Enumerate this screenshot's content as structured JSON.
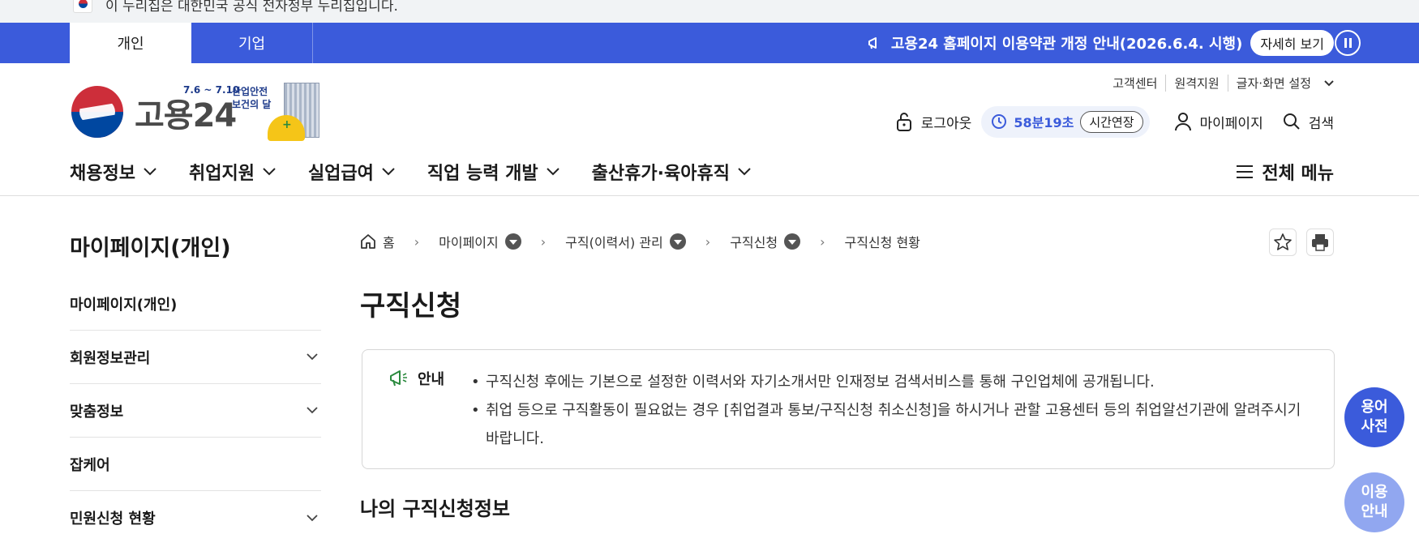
{
  "gov_banner": {
    "text": "이 누리집은 대한민국 공식 전자정부 누리집입니다."
  },
  "notice_bar": {
    "tabs": [
      {
        "label": "개인",
        "active": true
      },
      {
        "label": "기업",
        "active": false
      }
    ],
    "notice": "고용24 홈페이지 이용약관 개정 안내(2026.6.4. 시행)",
    "detail_label": "자세히 보기",
    "bg_color": "#3b5bdb"
  },
  "header": {
    "logo_text": "고용24",
    "campaign": {
      "date": "7.6 ~ 7.10",
      "line1": "산업안전",
      "line2": "보건의 달"
    },
    "util_links": [
      "고객센터",
      "원격지원",
      "글자·화면 설정"
    ],
    "logout_label": "로그아웃",
    "timer_remaining": "58분19초",
    "extend_label": "시간연장",
    "mypage_label": "마이페이지",
    "search_label": "검색"
  },
  "main_nav": {
    "items": [
      "채용정보",
      "취업지원",
      "실업급여",
      "직업 능력 개발",
      "출산휴가·육아휴직"
    ],
    "all_menu_label": "전체 메뉴"
  },
  "sidebar": {
    "title": "마이페이지(개인)",
    "items": [
      {
        "label": "마이페이지(개인)",
        "expandable": false
      },
      {
        "label": "회원정보관리",
        "expandable": true
      },
      {
        "label": "맞춤정보",
        "expandable": true
      },
      {
        "label": "잡케어",
        "expandable": false
      },
      {
        "label": "민원신청 현황",
        "expandable": true
      }
    ]
  },
  "breadcrumb": [
    "홈",
    "마이페이지",
    "구직(이력서) 관리",
    "구직신청",
    "구직신청 현황"
  ],
  "page": {
    "title": "구직신청",
    "info_label": "안내",
    "info_items": [
      "구직신청 후에는 기본으로 설정한 이력서와 자기소개서만 인재정보 검색서비스를 통해 구인업체에 공개됩니다.",
      "취업 등으로 구직활동이 필요없는 경우 [취업결과 통보/구직신청 취소신청]을 하시거나 관할 고용센터 등의 취업알선기관에 알려주시기 바랍니다."
    ],
    "section_title": "나의 구직신청정보"
  },
  "floating": {
    "dictionary": "용어\n사전",
    "guide": "이용\n안내"
  }
}
